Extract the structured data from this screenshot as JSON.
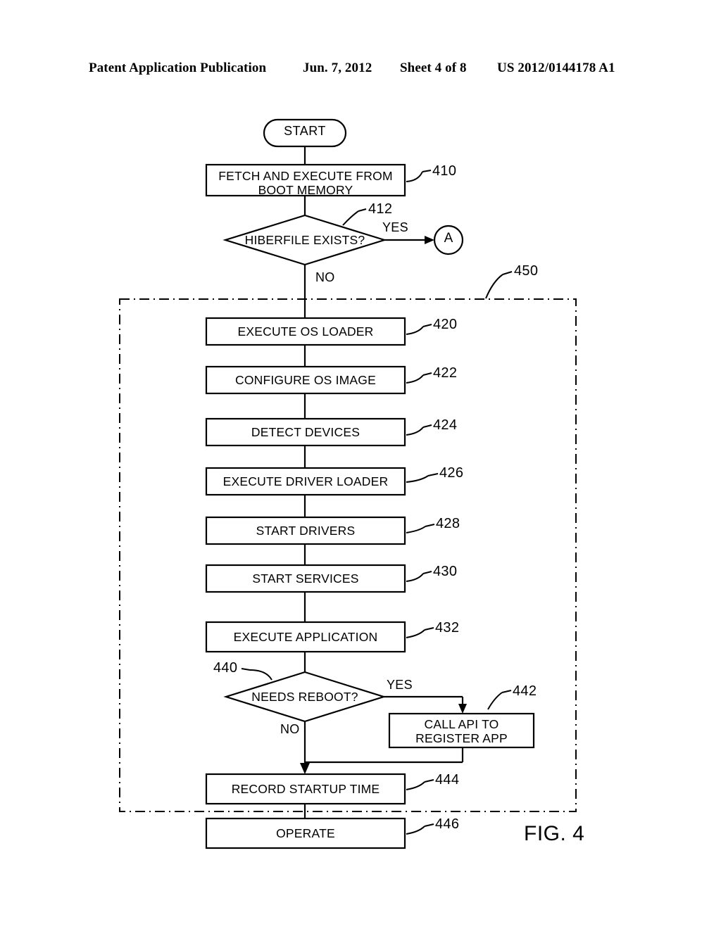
{
  "header": {
    "publication": "Patent Application Publication",
    "date": "Jun. 7, 2012",
    "sheet": "Sheet 4 of 8",
    "number": "US 2012/0144178 A1"
  },
  "figure": {
    "caption": "FIG. 4",
    "start_label": "START",
    "connector_a": "A",
    "group_ref": "450",
    "branches": {
      "hiberfile_yes": "YES",
      "hiberfile_no": "NO",
      "reboot_yes": "YES",
      "reboot_no": "NO"
    },
    "nodes": [
      {
        "id": "start",
        "shape": "terminator",
        "label": "START",
        "ref": ""
      },
      {
        "id": "n410",
        "shape": "process",
        "label": "FETCH AND EXECUTE FROM\nBOOT MEMORY",
        "ref": "410"
      },
      {
        "id": "n412",
        "shape": "decision",
        "label": "HIBERFILE EXISTS?",
        "ref": "412"
      },
      {
        "id": "n420",
        "shape": "process",
        "label": "EXECUTE OS LOADER",
        "ref": "420"
      },
      {
        "id": "n422",
        "shape": "process",
        "label": "CONFIGURE OS IMAGE",
        "ref": "422"
      },
      {
        "id": "n424",
        "shape": "process",
        "label": "DETECT DEVICES",
        "ref": "424"
      },
      {
        "id": "n426",
        "shape": "process",
        "label": "EXECUTE DRIVER LOADER",
        "ref": "426"
      },
      {
        "id": "n428",
        "shape": "process",
        "label": "START DRIVERS",
        "ref": "428"
      },
      {
        "id": "n430",
        "shape": "process",
        "label": "START SERVICES",
        "ref": "430"
      },
      {
        "id": "n432",
        "shape": "process",
        "label": "EXECUTE APPLICATION",
        "ref": "432"
      },
      {
        "id": "n440",
        "shape": "decision",
        "label": "NEEDS REBOOT?",
        "ref": "440"
      },
      {
        "id": "n442",
        "shape": "process",
        "label": "CALL API TO\nREGISTER APP",
        "ref": "442"
      },
      {
        "id": "n444",
        "shape": "process",
        "label": "RECORD STARTUP TIME",
        "ref": "444"
      },
      {
        "id": "n446",
        "shape": "process",
        "label": "OPERATE",
        "ref": "446"
      }
    ]
  }
}
